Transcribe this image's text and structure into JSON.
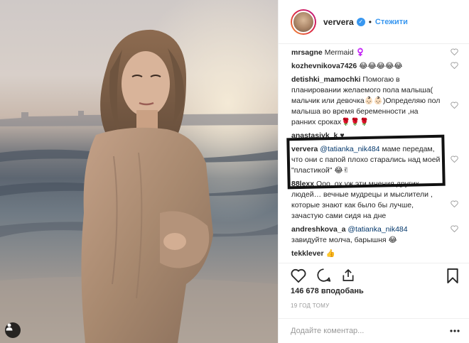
{
  "header": {
    "username": "ververa",
    "dot": "•",
    "follow_label": "Стежити"
  },
  "comments": [
    {
      "user": "mrsagne",
      "text": "Mermaid ♀️"
    },
    {
      "user": "kozhevnikova7426",
      "text": "😂😂😂😂😂"
    },
    {
      "user": "detishki_mamochki",
      "text": "Помогаю в планировании желаемого пола малыша( мальчик или девочка👶🏻👶🏻)Определяю пол малыша во время беременности ,на ранних сроках🌹🌹🌹"
    },
    {
      "user": "anastasiyk_k",
      "text": "♥"
    },
    {
      "user": "ververa",
      "mention": "@tatianka_nik484",
      "text": "маме передам, что они с папой плохо старались над моей \"пластикой\" 😂✌"
    },
    {
      "user": "88lexx",
      "text": "Ооо, ох уж эти мнения других людей… вечные мудрецы и мыслители , которые знают как было бы лучше, зачастую сами сидя на дне"
    },
    {
      "user": "andreshkova_a",
      "mention": "@tatianka_nik484",
      "text": "завидуйте молча, барышня 😂"
    },
    {
      "user": "tekklever",
      "text": "👍"
    }
  ],
  "likes": "146 678 вподобань",
  "timestamp": "19 ГОД ТОМУ",
  "add_comment": {
    "placeholder": "Додайте коментар..."
  },
  "icons": {
    "verified": "verified-badge-icon",
    "heart": "heart-outline-icon",
    "comment": "comment-bubble-icon",
    "share": "share-icon",
    "bookmark": "bookmark-icon",
    "more": "more-dots-icon",
    "user_tag": "user-tag-icon"
  },
  "colors": {
    "accent": "#3897f0",
    "text": "#262626",
    "muted": "#999999",
    "mention": "#003569",
    "border": "#efefef"
  }
}
